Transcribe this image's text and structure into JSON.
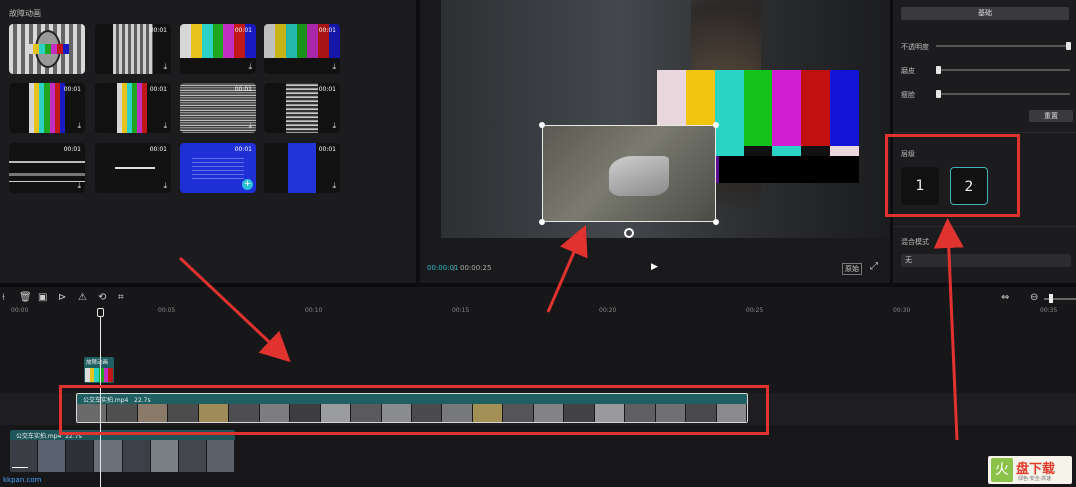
{
  "assets": {
    "title": "故障动画",
    "items": [
      {
        "duration": "",
        "download": false
      },
      {
        "duration": "00:01",
        "download": true
      },
      {
        "duration": "00:01",
        "download": true
      },
      {
        "duration": "00:01",
        "download": true
      },
      {
        "duration": "00:01",
        "download": true
      },
      {
        "duration": "00:01",
        "download": true
      },
      {
        "duration": "00:01",
        "download": true
      },
      {
        "duration": "00:01",
        "download": true
      },
      {
        "duration": "00:01",
        "download": true
      },
      {
        "duration": "00:01",
        "download": true
      },
      {
        "duration": "00:01",
        "download": false
      },
      {
        "duration": "00:01",
        "download": true
      }
    ],
    "download_glyph": "⤓"
  },
  "preview": {
    "current_time": "00:00:01",
    "total_time": "00:00:25",
    "separator": "/",
    "ratio_label": "原始",
    "play_icon": "▶",
    "fullscreen_icon": "⤢"
  },
  "props": {
    "tab_basic": "基础",
    "opacity_label": "不透明度",
    "sharpen_label": "磨皮",
    "thin_label": "瘦脸",
    "reset_label": "重置",
    "layer_label": "层级",
    "layer_1": "1",
    "layer_2": "2",
    "blend_label": "混合模式",
    "blend_value": "无",
    "opacity_value": 1.0,
    "sharpen_value": 0.0,
    "thin_value": 0.0
  },
  "timeline": {
    "ticks": [
      "00:00",
      "00:05",
      "00:10",
      "00:15",
      "00:20",
      "00:25",
      "00:30",
      "00:35"
    ],
    "sticker_label": "故障动画",
    "clip1_label": "公交车实拍.mp4",
    "clip1_duration": "22.7s",
    "clip2_label": "公交车实拍.mp4",
    "clip2_duration": "22.7s",
    "watermark": "kkpan.com",
    "tools": [
      "split-icon",
      "delete-icon",
      "freeze-icon",
      "play-circle-icon",
      "mirror-icon",
      "rotate-icon",
      "crop-icon"
    ],
    "tool_glyphs": [
      "⟊",
      "🗑",
      "▣",
      "⊳",
      "⚠",
      "⟲",
      "⌗"
    ]
  },
  "logo": {
    "char": "火",
    "text": "盘下载",
    "sub": "绿色·安全·高速"
  },
  "colors": {
    "highlight": "#e0322e",
    "clip_teal": "#1f5f62",
    "layer_active_border": "#3fb3b8"
  }
}
